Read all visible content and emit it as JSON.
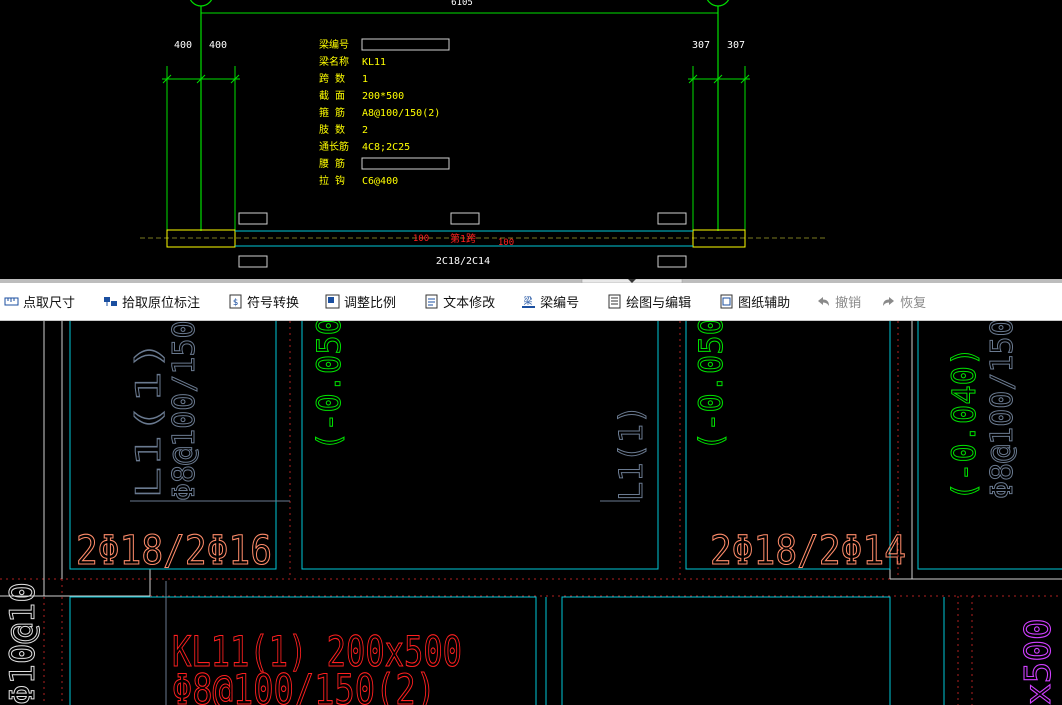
{
  "top_view": {
    "dim_total": "6105",
    "dim_left_a": "400",
    "dim_left_b": "400",
    "dim_right_a": "307",
    "dim_right_b": "307",
    "props": [
      {
        "label": "梁编号",
        "value": ""
      },
      {
        "label": "梁名称",
        "value": "KL11"
      },
      {
        "label": "跨 数",
        "value": "1"
      },
      {
        "label": "截 面",
        "value": "200*500"
      },
      {
        "label": "箍 筋",
        "value": "A8@100/150(2)"
      },
      {
        "label": "肢 数",
        "value": "2"
      },
      {
        "label": "通长筋",
        "value": "4C8;2C25"
      },
      {
        "label": "腰 筋",
        "value": ""
      },
      {
        "label": "拉 钩",
        "value": "C6@400"
      }
    ],
    "span_label": "第1跨",
    "dim_small_left": "100",
    "dim_small_right": "100",
    "bottom_rebar": "2C18/2C14"
  },
  "toolbar": {
    "items": [
      {
        "label": "点取尺寸",
        "icon": "ruler-icon"
      },
      {
        "label": "拾取原位标注",
        "icon": "pick-icon"
      },
      {
        "label": "符号转换",
        "icon": "symbol-icon"
      },
      {
        "label": "调整比例",
        "icon": "scale-icon"
      },
      {
        "label": "文本修改",
        "icon": "text-edit-icon"
      },
      {
        "label": "梁编号",
        "icon": "beam-number-icon"
      },
      {
        "label": "绘图与编辑",
        "icon": "draw-edit-icon"
      },
      {
        "label": "图纸辅助",
        "icon": "drawing-assist-icon"
      },
      {
        "label": "撤销",
        "icon": "undo-icon"
      },
      {
        "label": "恢复",
        "icon": "redo-icon"
      }
    ]
  },
  "cad": {
    "rebar_left": "2Φ18/2Φ16",
    "rebar_right": "2Φ18/2Φ14",
    "elev_a": "(-0.050)",
    "elev_b": "(-0.050)",
    "elev_c": "(-0.040)",
    "beam_l1": "L1(1)",
    "beam_main_1": "KL11(1) 200x500",
    "beam_main_2": "Φ8@100/150(2)",
    "vertical_left": "Φ10@10",
    "vertical_right": "x500"
  },
  "colors": {
    "green": "#00e000",
    "yellow": "#ffff00",
    "cyan": "#00c8d8",
    "red": "#ff2020",
    "salmon": "#ff8c6a",
    "magenta": "#d040ff",
    "grey": "#6a7a90"
  }
}
